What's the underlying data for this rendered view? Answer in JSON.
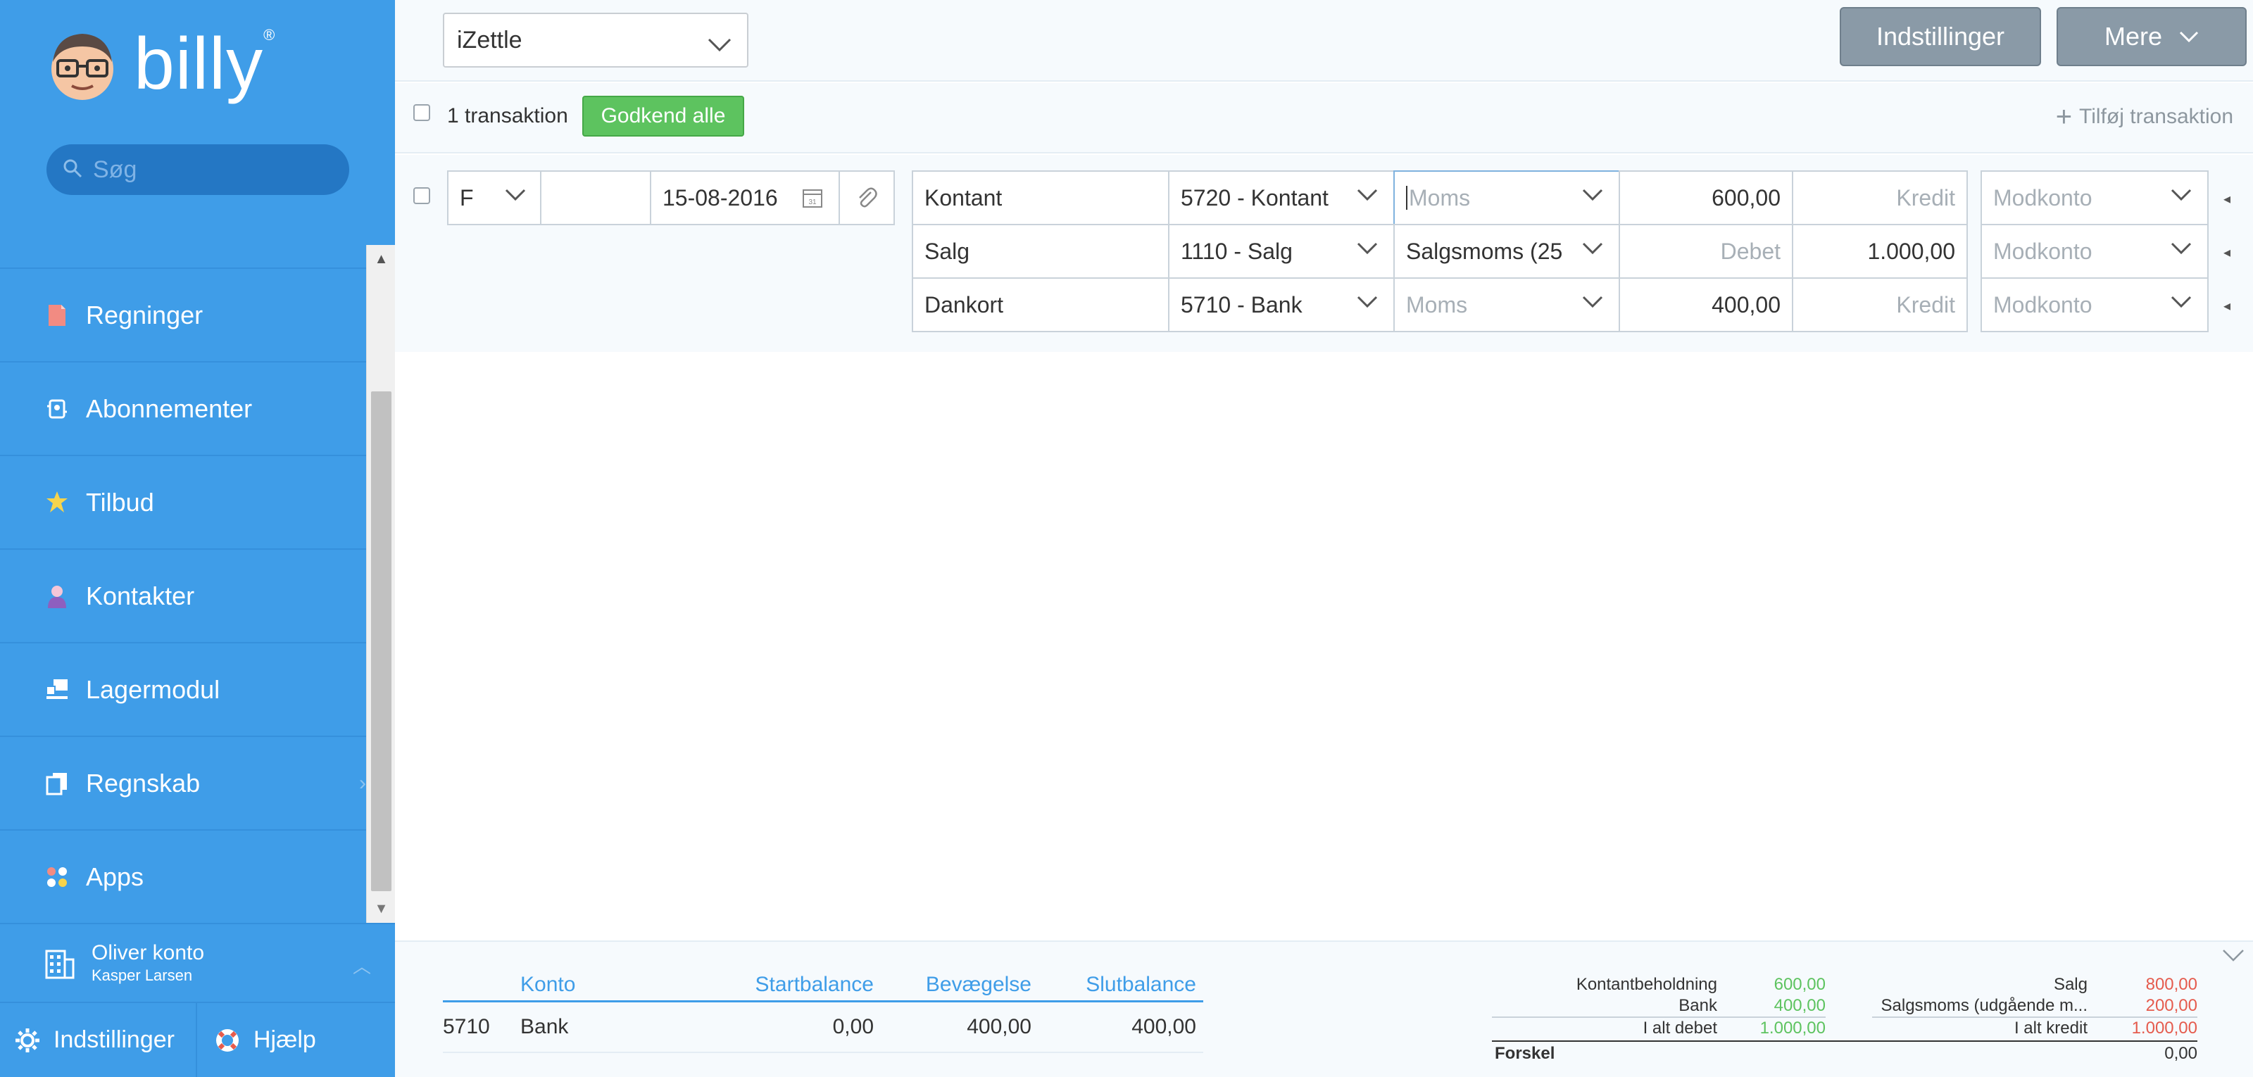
{
  "brand": {
    "name": "billy",
    "reg": "®"
  },
  "search": {
    "placeholder": "Søg"
  },
  "sidebar": {
    "items": [
      {
        "label": "Regninger",
        "icon": "invoice-icon"
      },
      {
        "label": "Abonnementer",
        "icon": "subscription-icon"
      },
      {
        "label": "Tilbud",
        "icon": "star-badge-icon"
      },
      {
        "label": "Kontakter",
        "icon": "person-icon"
      },
      {
        "label": "Lagermodul",
        "icon": "inventory-icon"
      },
      {
        "label": "Regnskab",
        "icon": "ledger-icon"
      },
      {
        "label": "Apps",
        "icon": "apps-icon"
      }
    ],
    "org": {
      "name": "Oliver konto",
      "user": "Kasper Larsen"
    },
    "footer": {
      "settings": "Indstillinger",
      "help": "Hjælp"
    }
  },
  "topbar": {
    "account": "iZettle",
    "settings_label": "Indstillinger",
    "more_label": "Mere"
  },
  "toolbar": {
    "count_label": "1 transaktion",
    "approve_label": "Godkend alle",
    "add_label": "Tilføj transaktion"
  },
  "transaction": {
    "type": "F",
    "voucher": "",
    "date": "15-08-2016",
    "lines": [
      {
        "description": "Kontant",
        "account": "5720 - Kontant",
        "vat": "Moms",
        "debit": "600,00",
        "credit": "Kredit",
        "counter": "Modkonto"
      },
      {
        "description": "Salg",
        "account": "1110 - Salg",
        "vat": "Salgsmoms (25",
        "debit": "Debet",
        "credit": "1.000,00",
        "counter": "Modkonto"
      },
      {
        "description": "Dankort",
        "account": "5710 - Bank",
        "vat": "Moms",
        "debit": "400,00",
        "credit": "Kredit",
        "counter": "Modkonto"
      }
    ]
  },
  "balances": {
    "headers": {
      "account": "Konto",
      "start": "Startbalance",
      "movement": "Bevægelse",
      "end": "Slutbalance"
    },
    "rows": [
      {
        "no": "5710",
        "account": "Bank",
        "start": "0,00",
        "movement": "400,00",
        "end": "400,00"
      }
    ]
  },
  "summary": {
    "debit_lines": [
      {
        "label": "Kontantbeholdning",
        "value": "600,00"
      },
      {
        "label": "Bank",
        "value": "400,00"
      }
    ],
    "total_debit": {
      "label": "I alt debet",
      "value": "1.000,00"
    },
    "credit_lines": [
      {
        "label": "Salg",
        "value": "800,00"
      },
      {
        "label": "Salgsmoms (udgående m...",
        "value": "200,00"
      }
    ],
    "total_credit": {
      "label": "I alt kredit",
      "value": "1.000,00"
    },
    "difference": {
      "label": "Forskel",
      "value": "0,00"
    }
  },
  "colors": {
    "sidebar": "#3f9de8",
    "accent": "#3f9de8",
    "approve": "#5dc35f",
    "debit": "#5dc35f",
    "credit": "#e55b4d",
    "grey_button": "#8a9aa7"
  }
}
